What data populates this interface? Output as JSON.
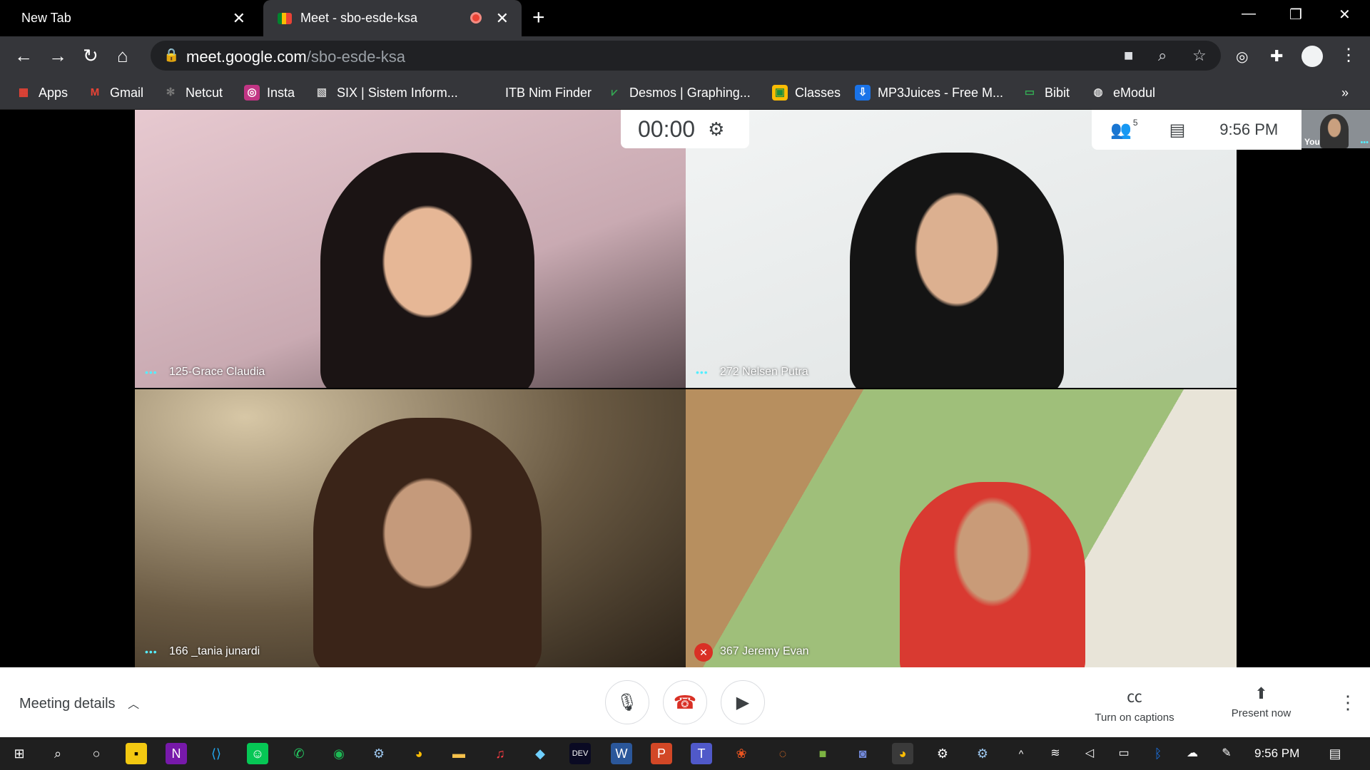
{
  "tabs": [
    {
      "title": "New Tab"
    },
    {
      "title": "Meet - sbo-esde-ksa"
    }
  ],
  "address": {
    "host": "meet.google.com",
    "path": "/sbo-esde-ksa"
  },
  "bookmarks": [
    {
      "label": "Apps"
    },
    {
      "label": "Gmail"
    },
    {
      "label": "Netcut"
    },
    {
      "label": "Insta"
    },
    {
      "label": "SIX | Sistem Inform..."
    },
    {
      "label": "ITB Nim Finder"
    },
    {
      "label": "Desmos | Graphing..."
    },
    {
      "label": "Classes"
    },
    {
      "label": "MP3Juices - Free M..."
    },
    {
      "label": "Bibit"
    },
    {
      "label": "eModul"
    }
  ],
  "meet": {
    "timer": "00:00",
    "participant_count": "5",
    "time": "9:56 PM",
    "self_label": "You",
    "participants": [
      {
        "name": "125-Grace Claudia"
      },
      {
        "name": "272 Nelsen Putra"
      },
      {
        "name": "166 _tania junardi"
      },
      {
        "name": "367 Jeremy Evan"
      }
    ]
  },
  "bottom": {
    "details_label": "Meeting details",
    "captions_label": "Turn on captions",
    "present_label": "Present now"
  },
  "taskbar": {
    "clock": "9:56 PM"
  },
  "colors": {
    "accent_red": "#d93025",
    "chrome_dark": "#35363a"
  }
}
